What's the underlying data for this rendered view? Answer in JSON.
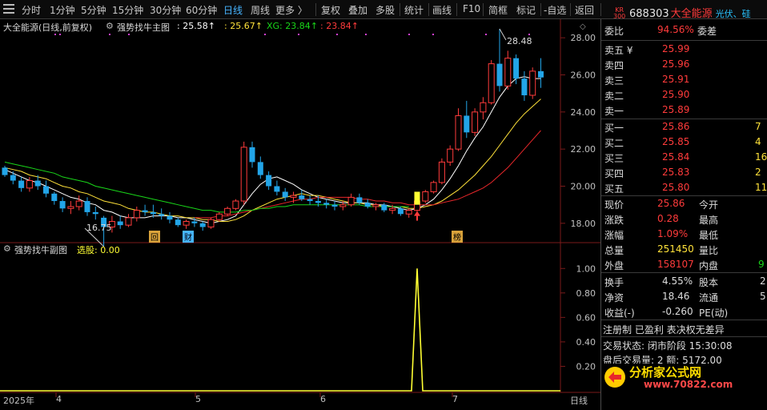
{
  "toolbar": {
    "items": [
      "分时",
      "1分钟",
      "5分钟",
      "15分钟",
      "30分钟",
      "60分钟",
      "日线",
      "周线",
      "更多 〉",
      "复权",
      "叠加",
      "多股",
      "统计",
      "画线",
      "F10",
      "简框",
      "标记",
      "-自选",
      "返回"
    ],
    "active": "日线"
  },
  "main_chart": {
    "title": "大全能源(日线,前复权)",
    "indicator_name": "强势找牛主图",
    "value1": ": 25.58↑",
    "value2": ": 25.67↑",
    "xg_label": "XG: 23.84↑",
    "value4": ": 23.84↑",
    "high_label": "28.48",
    "low_label": "16.75",
    "markers": [
      "回",
      "财",
      "榜"
    ]
  },
  "sub_chart": {
    "title": "强势找牛副图",
    "select_label": "选股: 0.00"
  },
  "time_axis": {
    "labels": [
      "2025年",
      "4",
      "5",
      "6",
      "7"
    ],
    "period": "日线"
  },
  "quote": {
    "badge_top": "KR",
    "badge_bottom": "300",
    "code": "688303",
    "name": "大全能源",
    "sector": "光伏、硅",
    "weibi_label": "委比",
    "weibi_value": "94.56%",
    "weicha_label": "委差",
    "sell": [
      {
        "label": "卖五 ¥",
        "price": "25.99"
      },
      {
        "label": "卖四",
        "price": "25.96"
      },
      {
        "label": "卖三",
        "price": "25.91"
      },
      {
        "label": "卖二",
        "price": "25.90"
      },
      {
        "label": "卖一",
        "price": "25.89"
      }
    ],
    "buy": [
      {
        "label": "买一",
        "price": "25.86",
        "vol": "7"
      },
      {
        "label": "买二",
        "price": "25.85",
        "vol": "4"
      },
      {
        "label": "买三",
        "price": "25.84",
        "vol": "16"
      },
      {
        "label": "买四",
        "price": "25.83",
        "vol": "2"
      },
      {
        "label": "买五",
        "price": "25.80",
        "vol": "11"
      }
    ],
    "stats1": [
      {
        "l1": "现价",
        "v1": "25.86",
        "l2": "今开"
      },
      {
        "l1": "涨跌",
        "v1": "0.28",
        "l2": "最高"
      },
      {
        "l1": "涨幅",
        "v1": "1.09%",
        "l2": "最低"
      },
      {
        "l1": "总量",
        "v1": "251450",
        "l2": "量比"
      },
      {
        "l1": "外盘",
        "v1": "158107",
        "l2": "内盘",
        "v2": "9"
      }
    ],
    "stats2": [
      {
        "l1": "换手",
        "v1": "4.55%",
        "l2": "股本",
        "v2": "2"
      },
      {
        "l1": "净资",
        "v1": "18.46",
        "l2": "流通",
        "v2": "5"
      },
      {
        "l1": "收益(-)",
        "v1": "-0.260",
        "l2": "PE(动)"
      }
    ],
    "tags": "注册制  已盈利  表决权无差异",
    "trade_status": "交易状态: 闭市阶段 15:30:08",
    "after_hours": "盘后交易量: 2  额: 5172.00"
  },
  "watermark": {
    "text": "分析家公式网",
    "url": "www.70822.com"
  },
  "colors": {
    "up": "#ff3b3b",
    "down": "#22a5e8",
    "ma5": "#ffffff",
    "ma10": "#ffe23a",
    "ma20": "#e8272a",
    "ma60": "#19d619",
    "signal": "#ffff33",
    "axis_text": "#c0c0c0",
    "grid": "#3a0000"
  },
  "chart_data": [
    {
      "type": "candlestick",
      "title": "大全能源(日线,前复权)",
      "x": [
        "2025年",
        "4",
        "5",
        "6",
        "7"
      ],
      "y_ticks": [
        18.0,
        20.0,
        22.0,
        24.0,
        26.0,
        28.0
      ],
      "ylim": [
        17.0,
        29.0
      ],
      "annotations": {
        "high": 28.48,
        "low": 16.75
      },
      "candles": [
        [
          21.0,
          21.1,
          20.5,
          20.6
        ],
        [
          20.6,
          20.8,
          20.1,
          20.3
        ],
        [
          20.3,
          20.5,
          19.7,
          19.9
        ],
        [
          19.9,
          20.5,
          19.7,
          20.3
        ],
        [
          20.3,
          20.6,
          19.8,
          20.0
        ],
        [
          20.0,
          20.3,
          19.4,
          19.6
        ],
        [
          19.6,
          19.7,
          19.0,
          19.2
        ],
        [
          19.2,
          19.4,
          18.6,
          18.8
        ],
        [
          18.8,
          19.2,
          18.5,
          18.9
        ],
        [
          18.9,
          19.5,
          18.7,
          19.2
        ],
        [
          19.2,
          19.4,
          18.4,
          18.6
        ],
        [
          18.6,
          18.9,
          18.2,
          18.5
        ],
        [
          18.3,
          18.4,
          16.75,
          17.8
        ],
        [
          17.8,
          18.4,
          17.5,
          18.1
        ],
        [
          18.1,
          18.4,
          17.7,
          17.9
        ],
        [
          17.9,
          18.5,
          17.8,
          18.3
        ],
        [
          18.3,
          18.9,
          18.1,
          18.7
        ],
        [
          18.7,
          19.0,
          18.4,
          18.6
        ],
        [
          18.6,
          19.0,
          18.3,
          18.5
        ],
        [
          18.5,
          18.8,
          18.2,
          18.4
        ],
        [
          18.4,
          18.6,
          18.0,
          18.2
        ],
        [
          18.2,
          18.3,
          17.8,
          17.9
        ],
        [
          17.9,
          18.2,
          17.7,
          18.1
        ],
        [
          18.1,
          18.3,
          17.8,
          18.0
        ],
        [
          18.0,
          18.1,
          17.6,
          17.8
        ],
        [
          17.8,
          18.3,
          17.7,
          18.2
        ],
        [
          18.2,
          18.6,
          18.1,
          18.5
        ],
        [
          18.5,
          18.9,
          18.4,
          18.8
        ],
        [
          18.8,
          19.3,
          18.7,
          19.2
        ],
        [
          19.2,
          22.4,
          19.0,
          22.1
        ],
        [
          22.1,
          22.4,
          21.0,
          21.3
        ],
        [
          21.3,
          21.6,
          20.4,
          20.6
        ],
        [
          20.6,
          20.8,
          19.8,
          20.0
        ],
        [
          20.0,
          20.3,
          19.5,
          19.7
        ],
        [
          19.7,
          19.9,
          19.2,
          19.4
        ],
        [
          19.4,
          19.7,
          19.1,
          19.5
        ],
        [
          19.5,
          19.8,
          19.2,
          19.3
        ],
        [
          19.3,
          19.5,
          19.0,
          19.2
        ],
        [
          19.2,
          19.5,
          18.9,
          19.1
        ],
        [
          19.1,
          19.3,
          18.8,
          19.0
        ],
        [
          19.0,
          19.2,
          18.7,
          18.9
        ],
        [
          18.9,
          19.2,
          18.7,
          19.0
        ],
        [
          19.0,
          19.6,
          18.9,
          19.4
        ],
        [
          19.4,
          19.6,
          19.0,
          19.1
        ],
        [
          19.1,
          19.3,
          18.8,
          18.9
        ],
        [
          18.9,
          19.1,
          18.7,
          19.0
        ],
        [
          19.0,
          19.1,
          18.6,
          18.7
        ],
        [
          18.7,
          19.0,
          18.5,
          18.8
        ],
        [
          18.8,
          18.9,
          18.4,
          18.5
        ],
        [
          18.5,
          18.8,
          18.3,
          18.7
        ],
        [
          18.7,
          19.4,
          18.6,
          19.2
        ],
        [
          19.2,
          19.8,
          19.1,
          19.7
        ],
        [
          19.7,
          20.3,
          19.6,
          20.2
        ],
        [
          20.2,
          21.5,
          20.1,
          21.3
        ],
        [
          21.3,
          22.2,
          21.1,
          22.0
        ],
        [
          22.0,
          24.2,
          21.9,
          23.8
        ],
        [
          23.8,
          24.6,
          22.6,
          22.9
        ],
        [
          22.9,
          24.2,
          22.7,
          24.0
        ],
        [
          24.0,
          24.8,
          23.6,
          24.5
        ],
        [
          24.5,
          26.8,
          24.4,
          26.6
        ],
        [
          26.6,
          28.48,
          25.1,
          25.4
        ],
        [
          25.4,
          27.3,
          25.2,
          26.9
        ],
        [
          26.9,
          27.1,
          25.5,
          25.8
        ],
        [
          25.8,
          26.2,
          24.6,
          24.9
        ],
        [
          24.9,
          26.4,
          24.7,
          26.2
        ],
        [
          26.2,
          26.9,
          25.3,
          25.86
        ]
      ],
      "series": [
        {
          "name": "ma_white",
          "values": [
            20.9,
            20.7,
            20.5,
            20.3,
            20.2,
            20.0,
            19.8,
            19.6,
            19.4,
            19.3,
            19.1,
            19.0,
            18.7,
            18.6,
            18.4,
            18.3,
            18.3,
            18.3,
            18.4,
            18.4,
            18.4,
            18.3,
            18.3,
            18.2,
            18.1,
            18.0,
            18.1,
            18.2,
            18.4,
            19.0,
            19.6,
            20.1,
            20.4,
            20.5,
            20.3,
            20.1,
            19.8,
            19.6,
            19.4,
            19.3,
            19.2,
            19.1,
            19.1,
            19.1,
            19.1,
            19.0,
            19.0,
            18.9,
            18.8,
            18.7,
            18.8,
            19.0,
            19.3,
            19.8,
            20.4,
            21.1,
            21.9,
            22.6,
            23.2,
            24.0,
            24.8,
            25.4,
            25.8,
            25.9,
            25.8,
            25.8
          ]
        },
        {
          "name": "ma_yellow",
          "values": [
            21.0,
            20.9,
            20.8,
            20.6,
            20.5,
            20.4,
            20.2,
            20.0,
            19.9,
            19.7,
            19.6,
            19.4,
            19.2,
            19.1,
            19.0,
            18.8,
            18.7,
            18.6,
            18.6,
            18.5,
            18.4,
            18.4,
            18.3,
            18.3,
            18.2,
            18.2,
            18.1,
            18.1,
            18.2,
            18.4,
            18.7,
            18.9,
            19.1,
            19.3,
            19.4,
            19.5,
            19.6,
            19.5,
            19.5,
            19.4,
            19.3,
            19.2,
            19.1,
            19.1,
            19.0,
            19.0,
            18.9,
            18.9,
            18.9,
            18.8,
            18.8,
            18.9,
            19.0,
            19.2,
            19.5,
            19.8,
            20.2,
            20.6,
            21.1,
            21.6,
            22.2,
            22.8,
            23.4,
            23.9,
            24.3,
            24.7
          ]
        },
        {
          "name": "ma_red",
          "values": [
            null,
            null,
            null,
            null,
            null,
            null,
            null,
            null,
            null,
            null,
            null,
            null,
            null,
            null,
            null,
            null,
            null,
            null,
            null,
            null,
            null,
            null,
            null,
            18.3,
            18.3,
            18.3,
            18.4,
            18.4,
            18.5,
            18.6,
            18.7,
            18.8,
            18.9,
            19.0,
            19.1,
            19.2,
            19.3,
            19.3,
            19.4,
            19.4,
            19.4,
            19.4,
            19.4,
            19.3,
            19.3,
            19.2,
            19.2,
            19.1,
            19.1,
            19.0,
            19.0,
            19.0,
            19.0,
            19.1,
            19.2,
            19.3,
            19.5,
            19.7,
            19.9,
            20.2,
            20.6,
            21.0,
            21.5,
            22.0,
            22.5,
            23.0
          ]
        },
        {
          "name": "ma_green",
          "values": [
            21.3,
            21.2,
            21.1,
            21.0,
            20.9,
            20.8,
            20.7,
            20.5,
            20.4,
            20.3,
            20.2,
            20.0,
            19.9,
            19.8,
            19.7,
            19.6,
            19.5,
            19.4,
            19.3,
            19.2,
            19.1,
            19.0,
            18.9,
            18.8,
            18.7,
            18.7,
            18.6,
            18.6,
            18.6,
            18.7,
            18.7,
            18.8,
            18.8,
            18.9,
            18.9,
            19.0,
            19.0,
            19.0,
            19.0,
            19.0,
            19.0,
            19.0,
            19.0,
            19.0,
            18.9,
            18.9,
            18.9,
            18.9,
            18.9,
            18.9,
            null,
            null,
            null,
            null,
            null,
            null,
            null,
            null,
            null,
            null,
            null,
            null,
            null,
            null,
            null,
            null
          ]
        }
      ]
    },
    {
      "type": "line",
      "title": "强势找牛副图",
      "y_ticks": [
        0.2,
        0.4,
        0.6,
        0.8,
        1.0
      ],
      "ylim": [
        0,
        1.1
      ],
      "series": [
        {
          "name": "选股",
          "spike_index": 50,
          "spike_value": 1.0,
          "baseline": 0.0
        }
      ]
    }
  ]
}
